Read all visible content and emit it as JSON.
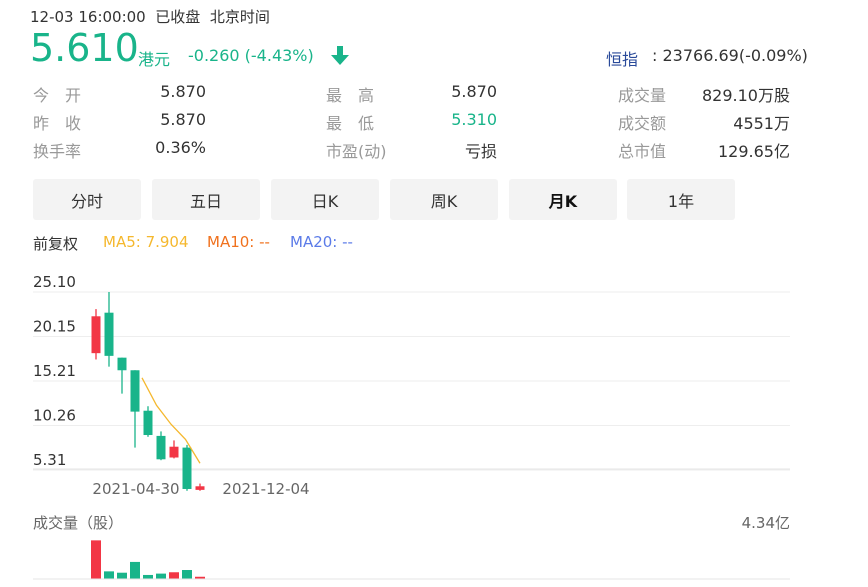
{
  "header": {
    "datetime": "12-03 16:00:00",
    "status": "已收盘",
    "timezone": "北京时间",
    "price": "5.610",
    "currency": "港元",
    "change": "-0.260 (-4.43%)",
    "index_name": "恒指",
    "index_value": ": 23766.69(-0.09%)"
  },
  "stats": {
    "open_label": "今　开",
    "open": "5.870",
    "prev_close_label": "昨　收",
    "prev_close": "5.870",
    "turnover_rate_label": "换手率",
    "turnover_rate": "0.36%",
    "high_label": "最　高",
    "high": "5.870",
    "low_label": "最　低",
    "low": "5.310",
    "pe_label": "市盈(动)",
    "pe": "亏损",
    "volume_label": "成交量",
    "volume": "829.10万股",
    "amount_label": "成交额",
    "amount": "4551万",
    "market_cap_label": "总市值",
    "market_cap": "129.65亿"
  },
  "tabs": [
    "分时",
    "五日",
    "日K",
    "周K",
    "月K",
    "1年"
  ],
  "active_tab": "月K",
  "legend": {
    "adjust": "前复权",
    "ma5": "MA5: 7.904",
    "ma10": "MA10: --",
    "ma20": "MA20: --"
  },
  "volume_panel": {
    "title": "成交量（股）",
    "max_label": "4.34亿"
  },
  "colors": {
    "up": "#f23645",
    "down": "#19b48a",
    "ma5": "#f5b82e",
    "ma10": "#f0711d",
    "ma20": "#5b7be8",
    "hsi": "#2a4a9a"
  },
  "chart_data": {
    "type": "candlestick",
    "y_ticks": [
      "25.10",
      "20.15",
      "15.21",
      "10.26",
      "5.31"
    ],
    "x_ticks": [
      "2021-04-30",
      "2021-12-04"
    ],
    "ylim": [
      5.31,
      25.1
    ],
    "candles": [
      {
        "open": 18.3,
        "close": 22.4,
        "high": 23.2,
        "low": 17.6
      },
      {
        "open": 22.8,
        "close": 18.0,
        "high": 25.1,
        "low": 16.8
      },
      {
        "open": 17.8,
        "close": 16.4,
        "high": 17.8,
        "low": 13.8
      },
      {
        "open": 16.4,
        "close": 11.8,
        "high": 16.4,
        "low": 7.8
      },
      {
        "open": 11.9,
        "close": 9.2,
        "high": 12.4,
        "low": 9.0
      },
      {
        "open": 9.1,
        "close": 6.5,
        "high": 9.6,
        "low": 6.4
      },
      {
        "open": 6.7,
        "close": 7.9,
        "high": 8.6,
        "low": 6.6
      },
      {
        "open": 7.8,
        "close": 3.2,
        "high": 8.1,
        "low": 3.0
      },
      {
        "open": 3.1,
        "close": 3.5,
        "high": 3.8,
        "low": 3.0
      }
    ],
    "ma5": [
      null,
      null,
      null,
      null,
      15.56,
      12.5,
      10.4,
      8.71,
      6.06
    ],
    "volume_max": 4.34,
    "volume_unit": "亿",
    "volumes": [
      4.3,
      0.85,
      0.7,
      1.9,
      0.45,
      0.6,
      0.75,
      1.0,
      0.25
    ],
    "volume_up": [
      true,
      false,
      false,
      false,
      false,
      false,
      true,
      false,
      true
    ]
  }
}
